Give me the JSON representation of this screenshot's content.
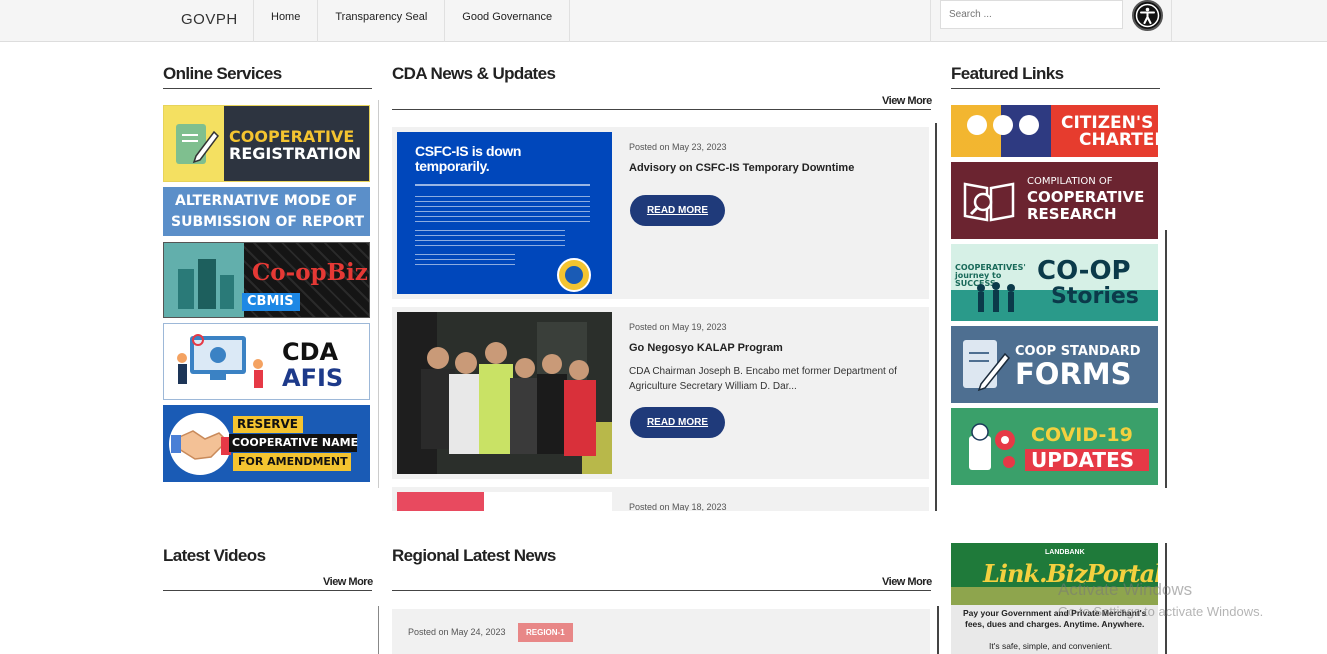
{
  "header": {
    "brand": "GOVPH",
    "nav": [
      "Home",
      "Transparency Seal",
      "Good Governance"
    ],
    "search_placeholder": "Search ...",
    "accessibility_icon": "accessibility-icon"
  },
  "online_services": {
    "title": "Online Services",
    "banners": [
      {
        "line1": "COOPERATIVE",
        "line2": "REGISTRATION"
      },
      {
        "line1": "ALTERNATIVE MODE OF",
        "line2": "SUBMISSION OF REPORT"
      },
      {
        "line1": "Co-opBiz",
        "line2": "CBMIS"
      },
      {
        "line1": "CDA",
        "line2": "AFIS"
      },
      {
        "line1": "RESERVE",
        "line2": "COOPERATIVE NAME",
        "line3": "FOR AMENDMENT"
      }
    ]
  },
  "news": {
    "title": "CDA News & Updates",
    "view_more": "View More",
    "items": [
      {
        "date": "Posted on May 23, 2023",
        "title": "Advisory on CSFC-IS Temporary Downtime",
        "excerpt": "",
        "read_more": "READ MORE",
        "thumb_heading": "CSFC-IS is down temporarily."
      },
      {
        "date": "Posted on May 19, 2023",
        "title": "Go Negosyo KALAP Program",
        "excerpt": "CDA Chairman Joseph B. Encabo met former Department of Agriculture Secretary William D. Dar...",
        "read_more": "READ MORE"
      },
      {
        "date": "Posted on May 18, 2023"
      }
    ]
  },
  "featured": {
    "title": "Featured Links",
    "banners": [
      {
        "line1": "CITIZEN'S",
        "line2": "CHARTER"
      },
      {
        "line1": "COMPILATION OF",
        "line2": "COOPERATIVE",
        "line3": "RESEARCH"
      },
      {
        "line1": "CO-OP",
        "line2": "Stories",
        "small": "COOPERATIVES' journey to SUCCESS"
      },
      {
        "line1": "COOP STANDARD",
        "line2": "FORMS"
      },
      {
        "line1": "COVID-19",
        "line2": "UPDATES"
      }
    ]
  },
  "videos": {
    "title": "Latest Videos",
    "view_more": "View More"
  },
  "regional": {
    "title": "Regional Latest News",
    "view_more": "View More",
    "items": [
      {
        "date": "Posted on May 24, 2023",
        "badge": "REGION-1"
      }
    ]
  },
  "landbank": {
    "small": "LANDBANK",
    "logo": "Link.BizPortal",
    "desc1": "Pay your Government and Private Merchant's",
    "desc2": "fees, dues and charges.  Anytime.  Anywhere.",
    "desc3": "It's safe, simple, and convenient."
  },
  "watermark": {
    "line1": "Activate Windows",
    "line2": "Go to Settings to activate Windows."
  },
  "colors": {
    "read_more_bg": "#1f3a7a",
    "badge_bg": "#e88787"
  }
}
